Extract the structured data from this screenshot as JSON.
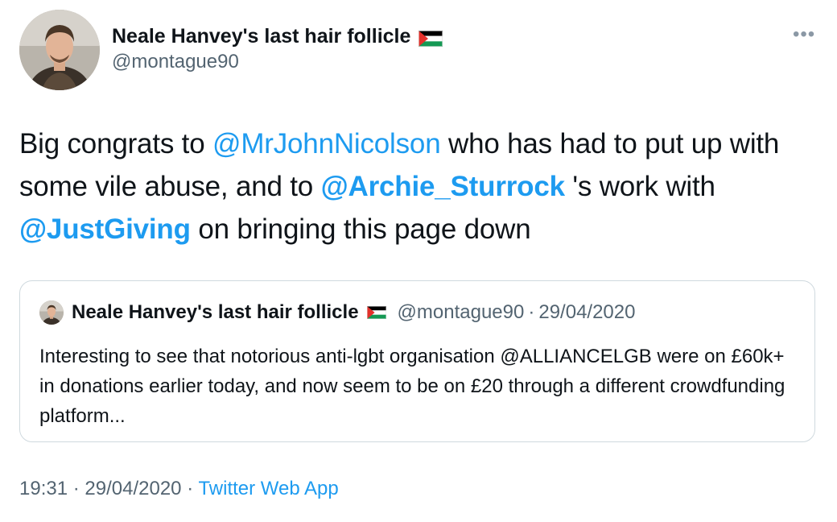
{
  "author": {
    "display_name": "Neale Hanvey's last hair follicle",
    "handle": "@montague90",
    "avatar_icon": "profile-photo",
    "flag_icon": "palestine-flag-icon"
  },
  "more_icon": "more-dots-icon",
  "tweet": {
    "text_1": "Big congrats to ",
    "mention_1": "@MrJohnNicolson",
    "text_2": " who has had to put up with some vile abuse, and to ",
    "mention_2": "@Archie_Sturrock",
    "text_3": " 's work with ",
    "mention_3": "@JustGiving",
    "text_4": " on bringing this page down"
  },
  "quoted_tweet": {
    "display_name": "Neale Hanvey's last hair follicle",
    "handle": "@montague90",
    "separator": "·",
    "date": "29/04/2020",
    "text": "Interesting to see that notorious anti-lgbt organisation @ALLIANCELGB were on £60k+ in donations earlier today, and now seem to be on £20 through a different crowdfunding platform..."
  },
  "meta": {
    "time": "19:31",
    "separator": "·",
    "date": "29/04/2020",
    "source": "Twitter Web App"
  },
  "colors": {
    "link": "#1d9bf0",
    "secondary_text": "#536471",
    "border": "#cfd9de"
  }
}
